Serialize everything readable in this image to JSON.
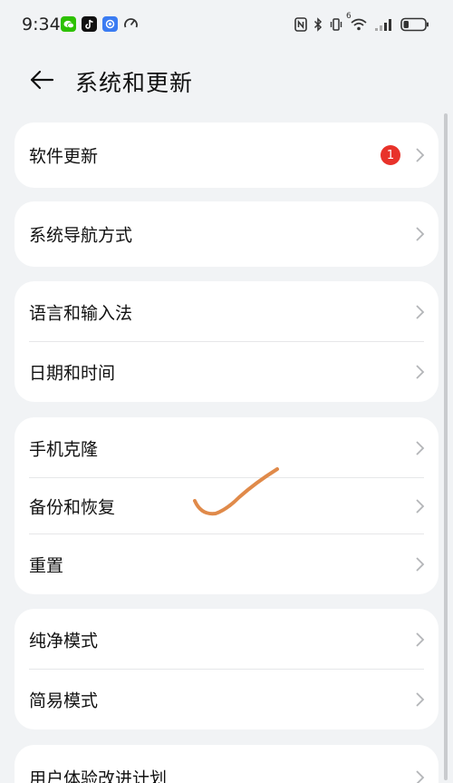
{
  "status_bar": {
    "time": "9:34",
    "app_icons": [
      "wechat-icon",
      "tiktok-icon",
      "app-icon",
      "speedometer-icon"
    ],
    "right_icons": [
      "nfc-icon",
      "bluetooth-icon",
      "vibrate-icon",
      "wifi-icon",
      "signal-icon",
      "battery-icon"
    ],
    "wifi_label": "6",
    "battery_level": 0.25
  },
  "header": {
    "title": "系统和更新"
  },
  "sections": [
    {
      "items": [
        {
          "label": "软件更新",
          "badge": "1"
        }
      ]
    },
    {
      "items": [
        {
          "label": "系统导航方式"
        }
      ]
    },
    {
      "items": [
        {
          "label": "语言和输入法"
        },
        {
          "label": "日期和时间"
        }
      ]
    },
    {
      "items": [
        {
          "label": "手机克隆"
        },
        {
          "label": "备份和恢复"
        },
        {
          "label": "重置"
        }
      ]
    },
    {
      "items": [
        {
          "label": "纯净模式"
        },
        {
          "label": "简易模式"
        }
      ]
    },
    {
      "items": [
        {
          "label": "用户体验改进计划"
        }
      ]
    }
  ],
  "colors": {
    "badge": "#e8322a",
    "annotation": "#e08a4a",
    "wechat": "#2dc100"
  }
}
